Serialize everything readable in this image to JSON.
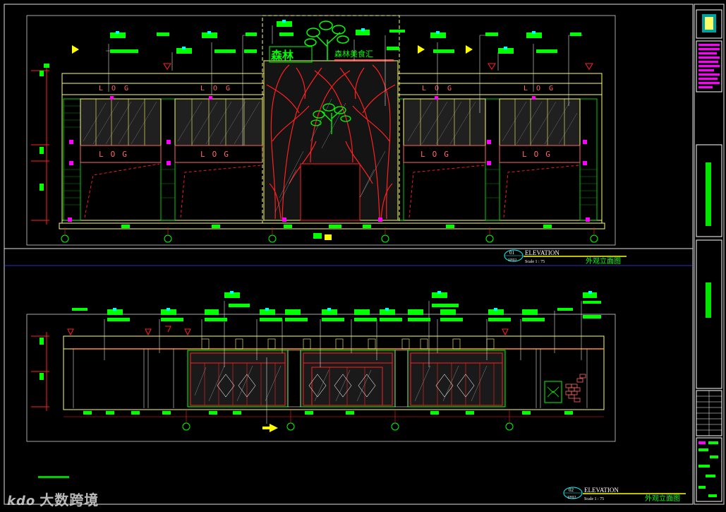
{
  "colors": {
    "background": "#000000",
    "frame": "#ffffff",
    "line": "#ffff66",
    "green": "#00ff00",
    "red": "#ff2020",
    "magenta": "#ff00ff",
    "cyan": "#00ffff",
    "blue": "#4040ff"
  },
  "sheet": {
    "view1": {
      "number": "01",
      "ref": "1F02",
      "title": "ELEVATION",
      "scale": "Scale 1 : 75",
      "caption": "外观立面图"
    },
    "view2": {
      "number": "02",
      "ref": "1F02",
      "title": "ELEVATION",
      "scale": "Scale 1 : 75",
      "caption": "外观立面图"
    },
    "brand": {
      "logo_text": "LOG",
      "signboard_name": "森林",
      "signboard_sub": "森林美食汇"
    }
  },
  "watermark": {
    "logo": "kdo",
    "text": "大数跨境"
  }
}
